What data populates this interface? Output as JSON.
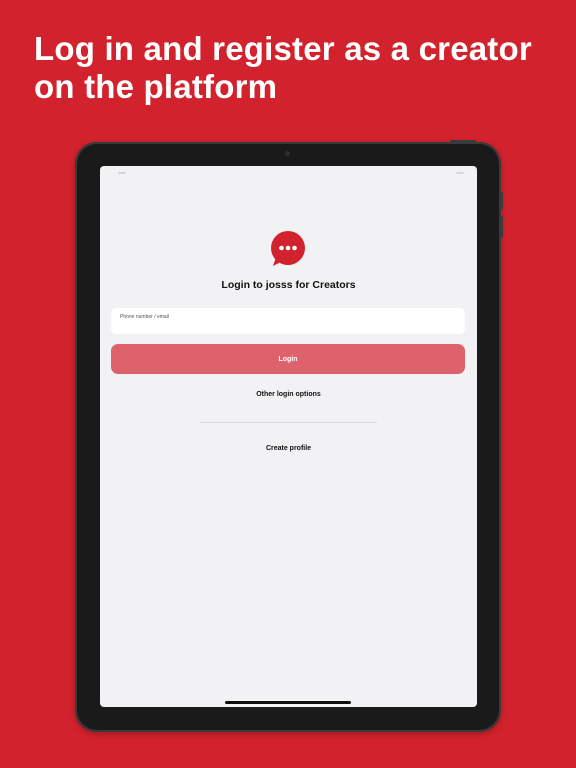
{
  "headline": "Log in and register as a creator on the platform",
  "app": {
    "title": "Login to josss for Creators",
    "phone_email_label": "Phone number / email",
    "login_label": "Login",
    "other_login_label": "Other login options",
    "create_profile_label": "Create profile",
    "logo_icon": "chat-bubble-dots-icon"
  },
  "colors": {
    "background": "#d2222d",
    "brand": "#d2222d",
    "login_button": "#dd626b",
    "screen": "#f2f2f4"
  }
}
